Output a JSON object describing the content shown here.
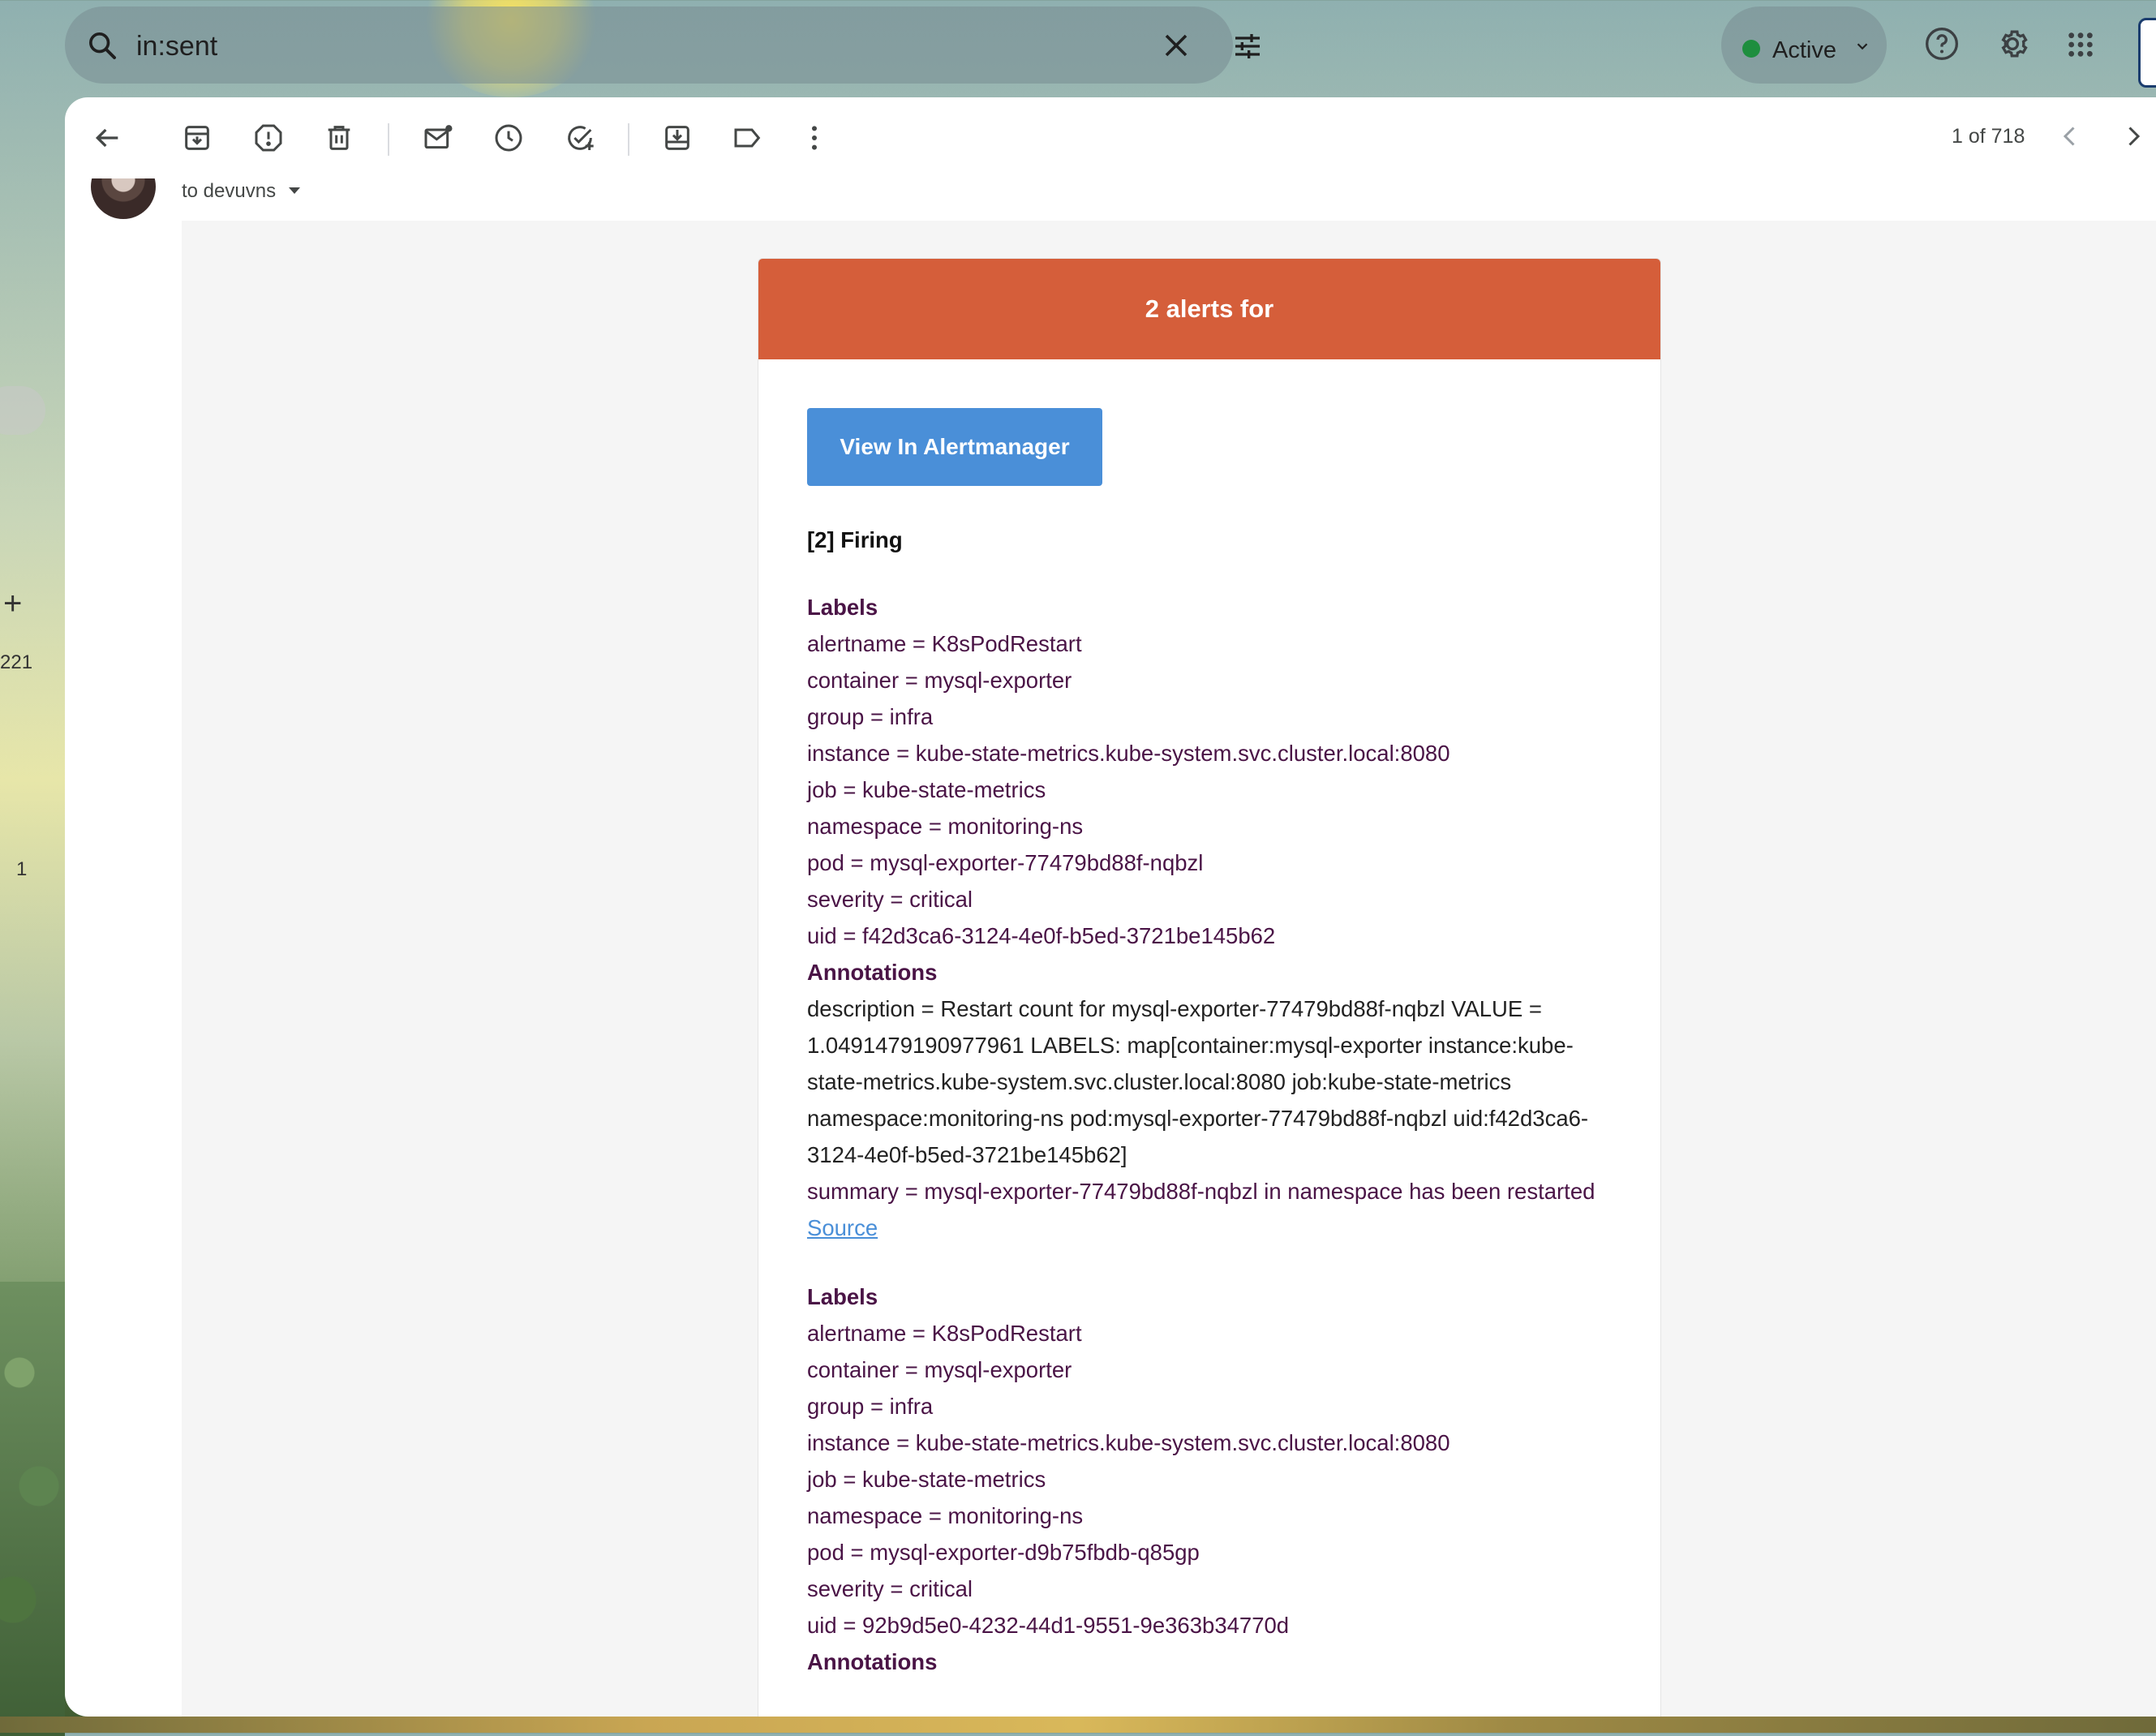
{
  "search": {
    "query": "in:sent"
  },
  "status": {
    "label": "Active",
    "color": "#1e8e3e"
  },
  "left_strip": {
    "count_a": "221",
    "count_b": "1"
  },
  "toolbar": {
    "pager": "1 of 718"
  },
  "message": {
    "recipient_line": "to devuvns",
    "header_text": "2 alerts for",
    "header_color": "#d55e3a",
    "button_label": "View In Alertmanager",
    "firing": "[2] Firing",
    "labels_title": "Labels",
    "annotations_title": "Annotations",
    "source_label": "Source",
    "alert1": {
      "labels": [
        "alertname = K8sPodRestart",
        "container = mysql-exporter",
        "group = infra",
        "instance = kube-state-metrics.kube-system.svc.cluster.local:8080",
        "job = kube-state-metrics",
        "namespace = monitoring-ns",
        "pod = mysql-exporter-77479bd88f-nqbzl",
        "severity = critical",
        "uid = f42d3ca6-3124-4e0f-b5ed-3721be145b62"
      ],
      "description": "description = Restart count for mysql-exporter-77479bd88f-nqbzl VALUE = 1.0491479190977961 LABELS: map[container:mysql-exporter instance:kube-state-metrics.kube-system.svc.cluster.local:8080 job:kube-state-metrics namespace:monitoring-ns pod:mysql-exporter-77479bd88f-nqbzl uid:f42d3ca6-3124-4e0f-b5ed-3721be145b62]",
      "summary": "summary = mysql-exporter-77479bd88f-nqbzl in namespace has been restarted"
    },
    "alert2": {
      "labels": [
        "alertname = K8sPodRestart",
        "container = mysql-exporter",
        "group = infra",
        "instance = kube-state-metrics.kube-system.svc.cluster.local:8080",
        "job = kube-state-metrics",
        "namespace = monitoring-ns",
        "pod = mysql-exporter-d9b75fbdb-q85gp",
        "severity = critical",
        "uid = 92b9d5e0-4232-44d1-9551-9e363b34770d"
      ]
    }
  }
}
